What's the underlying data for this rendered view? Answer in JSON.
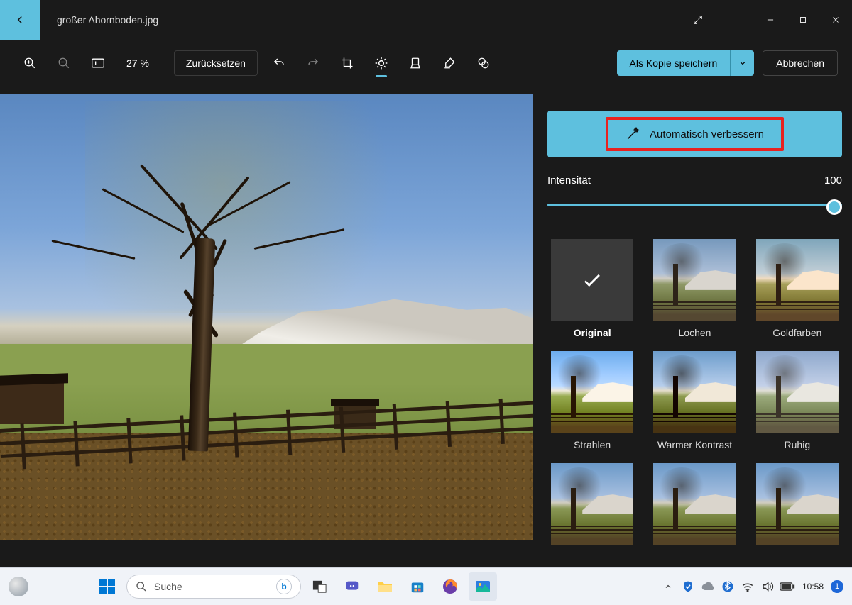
{
  "titlebar": {
    "filename": "großer Ahornboden.jpg"
  },
  "toolbar": {
    "zoom": "27 %",
    "reset": "Zurücksetzen",
    "save": "Als Kopie speichern",
    "cancel": "Abbrechen"
  },
  "panel": {
    "auto": "Automatisch verbessern",
    "intensity_label": "Intensität",
    "intensity_value": "100",
    "filters": {
      "original": "Original",
      "lochen": "Lochen",
      "gold": "Goldfarben",
      "strahlen": "Strahlen",
      "warm": "Warmer Kontrast",
      "ruhig": "Ruhig"
    }
  },
  "taskbar": {
    "search_placeholder": "Suche",
    "clock": "10:58",
    "notif": "1"
  }
}
